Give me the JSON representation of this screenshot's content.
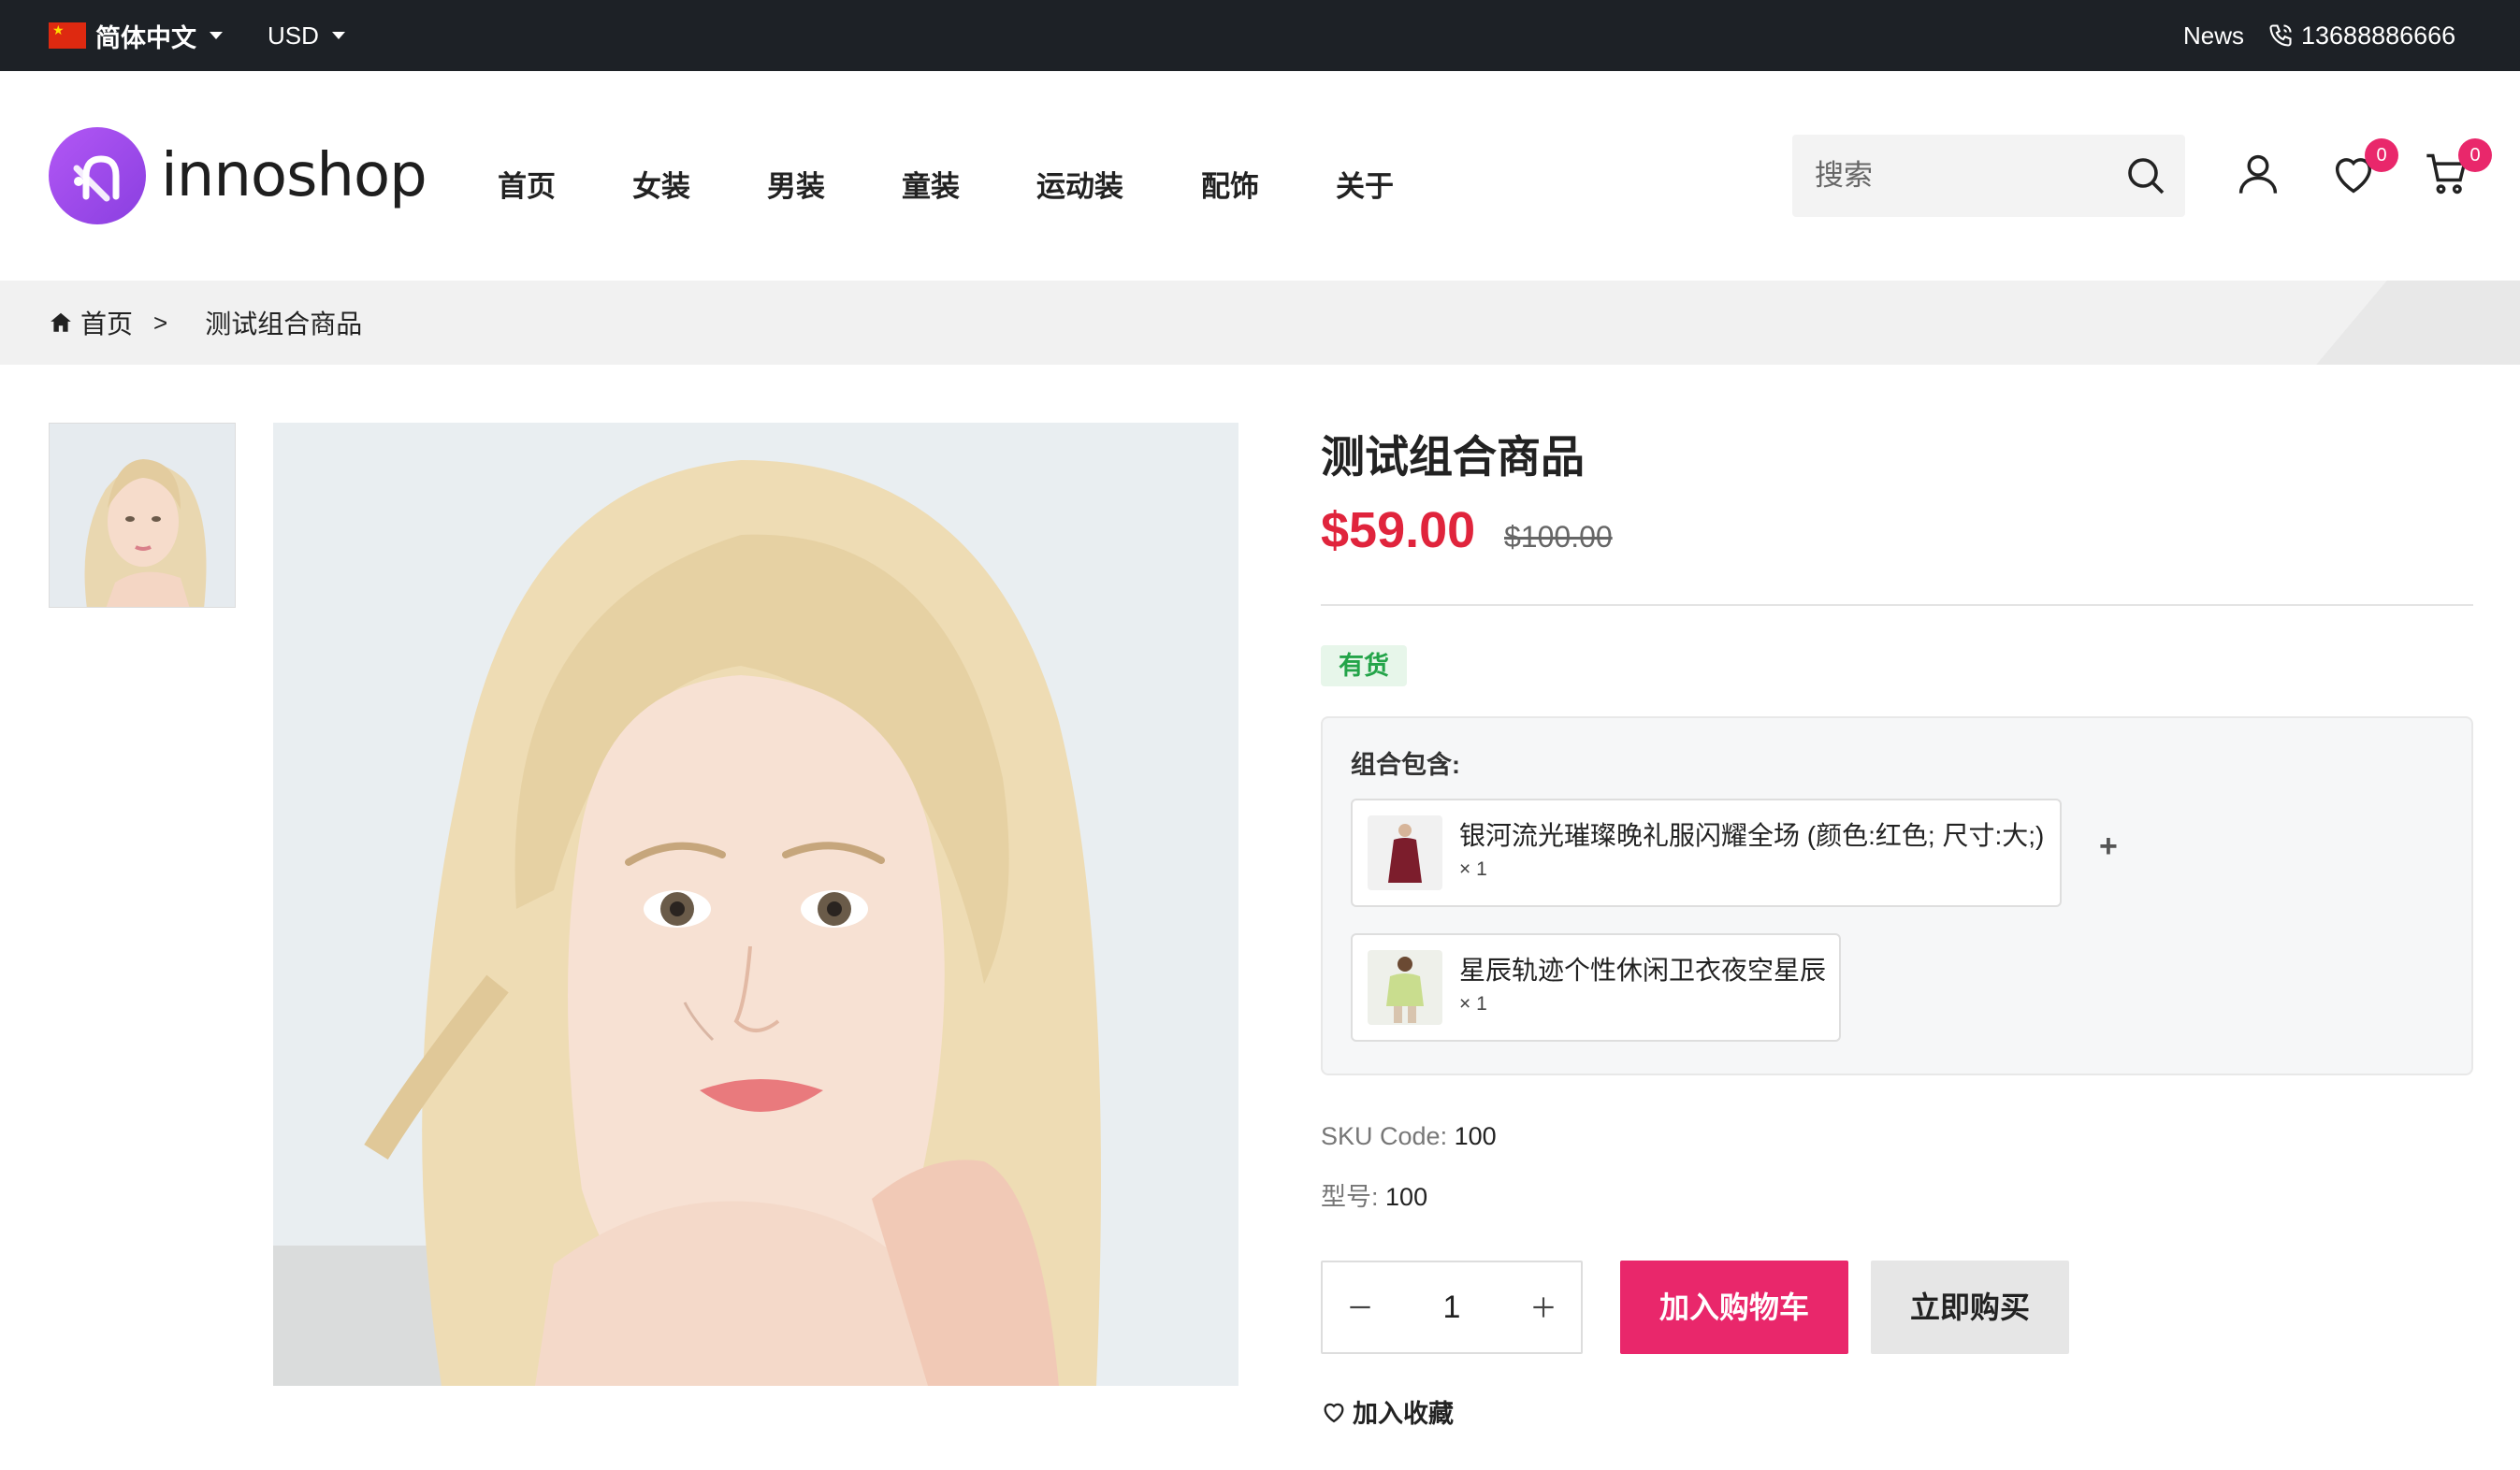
{
  "topbar": {
    "language": "简体中文",
    "currency": "USD",
    "news": "News",
    "phone": "13688886666"
  },
  "header": {
    "logo_text": "innoshop",
    "nav": [
      "首页",
      "女装",
      "男装",
      "童装",
      "运动装",
      "配饰",
      "关于"
    ],
    "search_placeholder": "搜索",
    "wishlist_count": "0",
    "cart_count": "0"
  },
  "breadcrumb": {
    "home": "首页",
    "separator": ">",
    "current": "测试组合商品"
  },
  "product": {
    "title": "测试组合商品",
    "price": "$59.00",
    "old_price": "$100.00",
    "stock": "有货",
    "bundle_label": "组合包含:",
    "bundle_items": [
      {
        "name": "银河流光璀璨晚礼服闪耀全场 (颜色:红色; 尺寸:大;)",
        "qty": "× 1"
      },
      {
        "name": "星辰轨迹个性休闲卫衣夜空星辰",
        "qty": "× 1"
      }
    ],
    "bundle_plus": "+",
    "sku_label": "SKU Code:",
    "sku_value": "100",
    "model_label": "型号:",
    "model_value": "100",
    "quantity": "1",
    "add_to_cart": "加入购物车",
    "buy_now": "立即购买",
    "add_to_wishlist": "加入收藏"
  },
  "colors": {
    "accent": "#e9276b",
    "price": "#e0243c",
    "stock_green": "#23a449",
    "logo_purple": "#a24ef0",
    "topbar_bg": "#1d2126"
  }
}
